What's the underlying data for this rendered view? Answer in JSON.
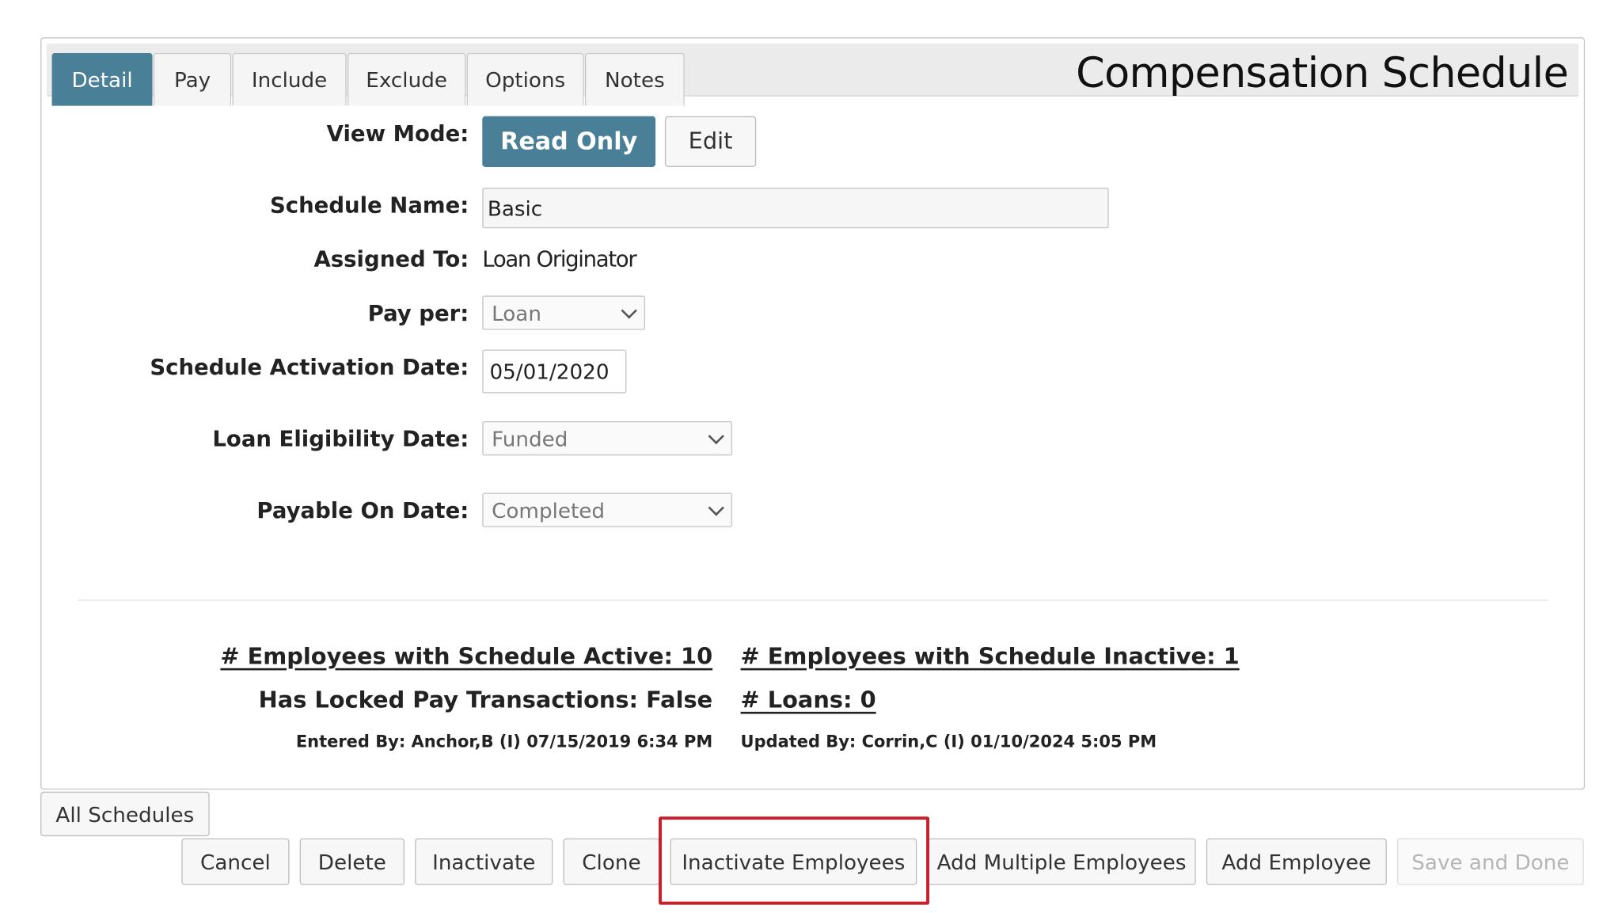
{
  "tabs": [
    {
      "label": "Detail",
      "active": true
    },
    {
      "label": "Pay",
      "active": false
    },
    {
      "label": "Include",
      "active": false
    },
    {
      "label": "Exclude",
      "active": false
    },
    {
      "label": "Options",
      "active": false
    },
    {
      "label": "Notes",
      "active": false
    }
  ],
  "header": {
    "title": "Compensation Schedule"
  },
  "form": {
    "view_mode_label": "View Mode:",
    "read_only_label": "Read Only",
    "edit_label": "Edit",
    "schedule_name_label": "Schedule Name:",
    "schedule_name_value": "Basic",
    "assigned_to_label": "Assigned To:",
    "assigned_to_value": "Loan Originator",
    "pay_per_label": "Pay per:",
    "pay_per_value": "Loan",
    "activation_date_label": "Schedule Activation Date:",
    "activation_date_value": "05/01/2020",
    "eligibility_label": "Loan Eligibility Date:",
    "eligibility_value": "Funded",
    "payable_label": "Payable On Date:",
    "payable_value": "Completed"
  },
  "stats": {
    "active": "# Employees with Schedule Active: 10",
    "inactive": "# Employees with Schedule Inactive: 1",
    "locked": "Has Locked Pay Transactions: False",
    "loans": "# Loans: 0",
    "entered_by": "Entered By: Anchor,B (I) 07/15/2019 6:34 PM",
    "updated_by": "Updated By: Corrin,C (I) 01/10/2024 5:05 PM"
  },
  "footer": {
    "all_schedules": "All Schedules",
    "cancel": "Cancel",
    "delete": "Delete",
    "inactivate": "Inactivate",
    "clone": "Clone",
    "inactivate_employees": "Inactivate Employees",
    "add_multiple": "Add Multiple Employees",
    "add_employee": "Add Employee",
    "save_done": "Save and Done"
  },
  "colors": {
    "accent": "#4a7f98",
    "highlight": "#c8202a"
  }
}
